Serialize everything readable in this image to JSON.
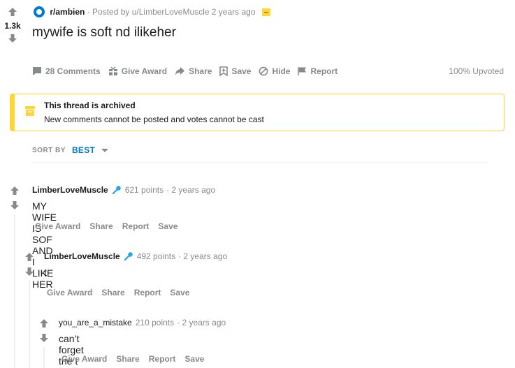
{
  "post": {
    "score": "1.3k",
    "subreddit": "r/ambien",
    "meta_prefix": "· Posted by u/LimberLoveMuscle 2 years ago",
    "title": "mywife is soft nd ilikeher",
    "actions": {
      "comments": "28 Comments",
      "give_award": "Give Award",
      "share": "Share",
      "save": "Save",
      "hide": "Hide",
      "report": "Report"
    },
    "upvoted": "100% Upvoted"
  },
  "banner": {
    "title": "This thread is archived",
    "text": "New comments cannot be posted and votes cannot be cast"
  },
  "sort": {
    "label": "SORT BY",
    "value": "BEST"
  },
  "comment_actions": {
    "give_award": "Give Award",
    "share": "Share",
    "report": "Report",
    "save": "Save"
  },
  "comments": [
    {
      "author": "LimberLoveMuscle",
      "points": "621 points",
      "time": "· 2 years ago",
      "body": "MY WIFE IS SOF AND I LIKE HER"
    },
    {
      "author": "LimberLoveMuscle",
      "points": "492 points",
      "time": "· 2 years ago",
      "body": "t"
    },
    {
      "author": "you_are_a_mistake",
      "points": "210 points",
      "time": "· 2 years ago",
      "body": "can’t forget the t"
    }
  ],
  "colors": {
    "accent": "#0079d3",
    "archive_yellow": "#ffd635",
    "meta_gray": "#878a8c",
    "vote_gray": "#878a8c"
  },
  "icons": {
    "upvote": "arrow-up-icon",
    "downvote": "arrow-down-icon",
    "comment": "comment-bubble-icon",
    "award": "gift-icon",
    "share": "share-arrow-icon",
    "save": "bookmark-icon",
    "hide": "hide-circle-slash-icon",
    "report": "flag-icon",
    "archive": "archive-box-icon",
    "op": "microphone-icon"
  }
}
